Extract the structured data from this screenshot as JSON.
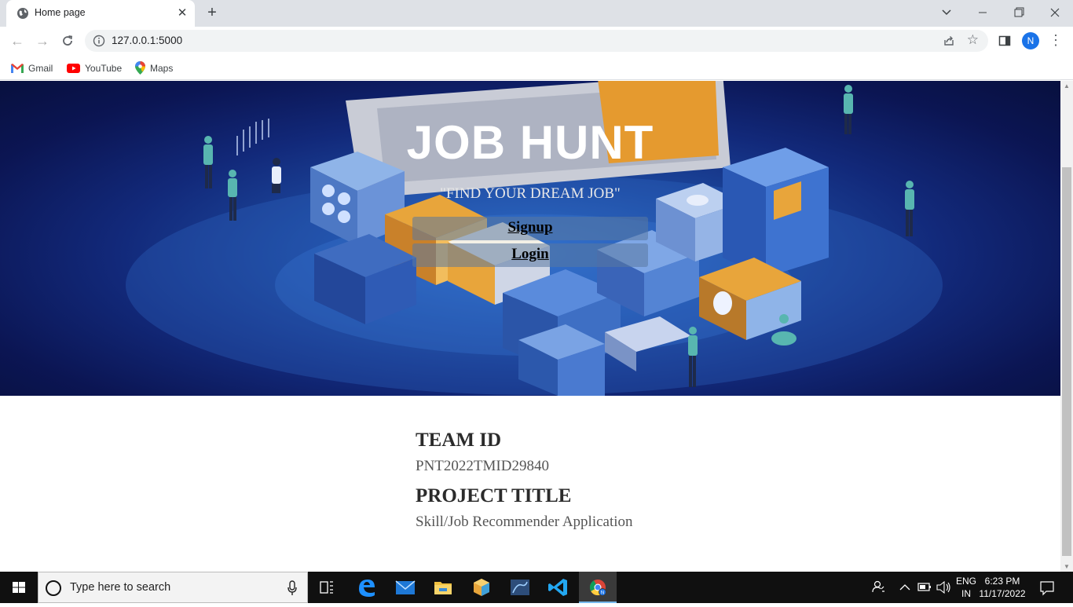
{
  "browser": {
    "tab_title": "Home page",
    "url": "127.0.0.1:5000",
    "profile_initial": "N",
    "bookmarks": [
      "Gmail",
      "YouTube",
      "Maps"
    ]
  },
  "hero": {
    "title": "JOB HUNT",
    "tagline": "\"FIND YOUR DREAM JOB\"",
    "signup_label": "Signup",
    "login_label": "Login"
  },
  "info": {
    "team_id_heading": "TEAM ID",
    "team_id_value": "PNT2022TMID29840",
    "project_title_heading": "PROJECT TITLE",
    "project_title_value": "Skill/Job Recommender Application"
  },
  "taskbar": {
    "search_placeholder": "Type here to search",
    "lang_top": "ENG",
    "lang_bottom": "IN",
    "time": "6:23 PM",
    "date": "11/17/2022"
  },
  "colors": {
    "hero_dark": "#0b1553",
    "hero_mid": "#1d4aa0",
    "accent_blue": "#1a73e8"
  }
}
